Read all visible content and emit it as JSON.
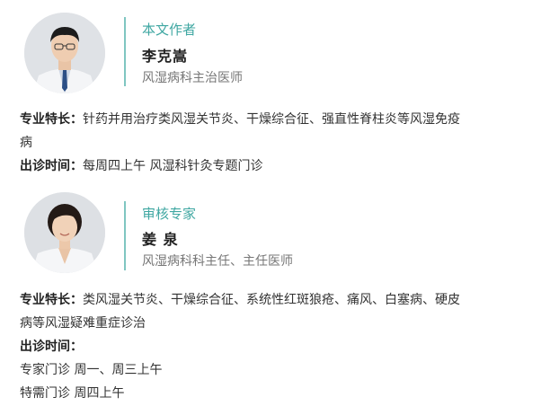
{
  "author": {
    "role": "本文作者",
    "name": "李克嵩",
    "title": "风湿病科主治医师",
    "specialty_label": "专业特长：",
    "specialty_line1": "针药并用治疗类风湿关节炎、干燥综合征、强直性脊柱炎等风湿免疫",
    "specialty_line2": "病",
    "clinic_label": "出诊时间：",
    "clinic_text": "每周四上午 风湿科针灸专题门诊"
  },
  "reviewer": {
    "role": "审核专家",
    "name": "姜 泉",
    "title": "风湿病科科主任、主任医师",
    "specialty_label": "专业特长：",
    "specialty_line1": "类风湿关节炎、干燥综合征、系统性红斑狼疮、痛风、白塞病、硬皮",
    "specialty_line2": "病等风湿疑难重症诊治",
    "clinic_label": "出诊时间：",
    "clinic_line1": "专家门诊 周一、周三上午",
    "clinic_line2": "特需门诊 周四上午"
  },
  "colors": {
    "accent": "#3fa7a2",
    "divider": "#7fc6c1",
    "text": "#333333",
    "subtext": "#777777"
  }
}
